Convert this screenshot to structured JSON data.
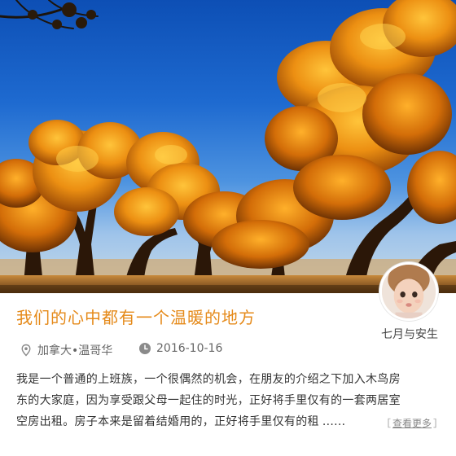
{
  "hero": {
    "icon": "populus-forest-photo"
  },
  "author": {
    "name": "七月与安生",
    "avatar_icon": "child-portrait-avatar"
  },
  "post": {
    "title": "我们的心中都有一个温暖的地方",
    "location": "加拿大•温哥华",
    "location_icon": "location-pin-icon",
    "date": "2016-10-16",
    "date_icon": "clock-icon",
    "body_lines": [
      "我是一个普通的上班族，一个很偶然的机会，在朋友的介绍之下加入木鸟房",
      "东的大家庭，因为享受跟父母一起住的时光，正好将手里仅有的一套两居室",
      "空房出租。房子本来是留着结婚用的，正好将手里仅有的租"
    ],
    "ellipsis": "......",
    "more_open": "［",
    "more_label": "查看更多",
    "more_close": "］"
  },
  "colors": {
    "title": "#e58a1a",
    "text": "#333333",
    "meta": "#666666"
  }
}
